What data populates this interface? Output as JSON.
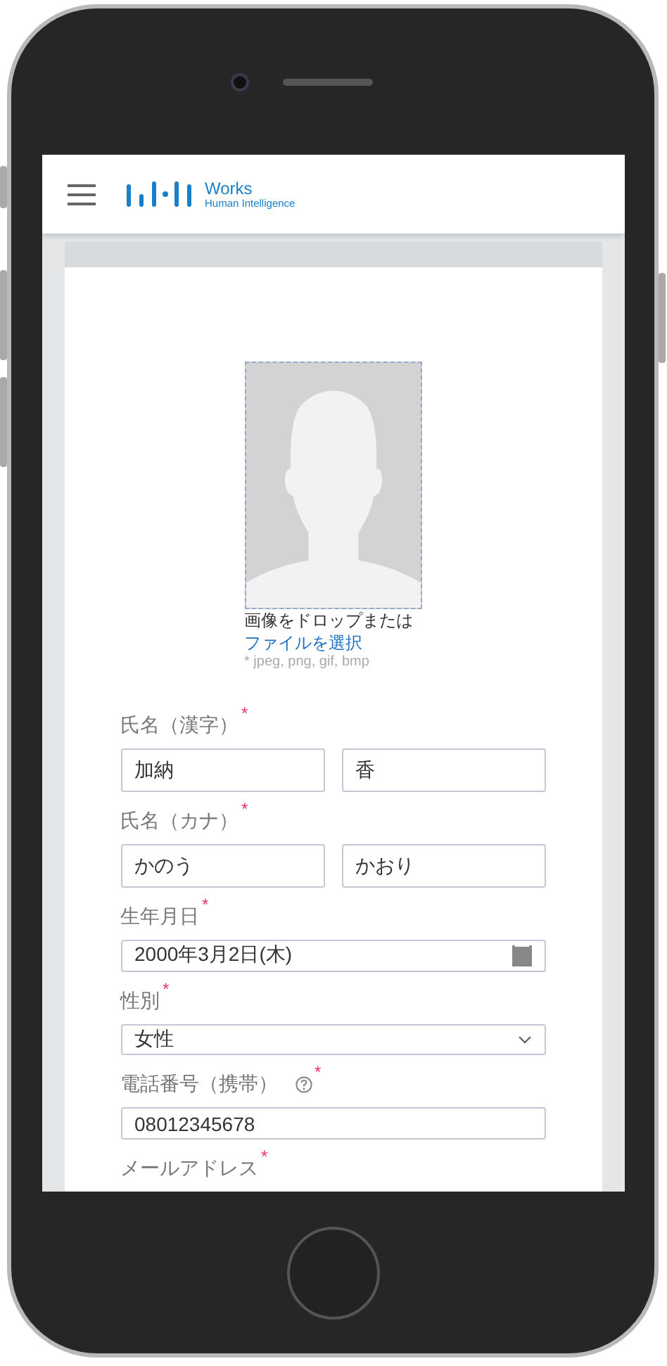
{
  "header": {
    "logo": {
      "title": "Works",
      "subtitle": "Human Intelligence"
    }
  },
  "upload": {
    "instruction": "画像をドロップまたは",
    "link": "ファイルを選択",
    "hint": "* jpeg, png, gif, bmp"
  },
  "fields": [
    {
      "kind": "pair",
      "label": "氏名（漢字）",
      "required_mark": "*",
      "help": false,
      "values": [
        "加納",
        "香"
      ]
    },
    {
      "kind": "pair",
      "label": "氏名（カナ）",
      "required_mark": "*",
      "help": false,
      "values": [
        "かのう",
        "かおり"
      ]
    },
    {
      "kind": "date",
      "label": "生年月日",
      "required_mark": "*",
      "help": false,
      "values": [
        "2000年3月2日(木)"
      ]
    },
    {
      "kind": "select",
      "label": "性別",
      "required_mark": "*",
      "help": false,
      "values": [
        "女性"
      ]
    },
    {
      "kind": "text",
      "label": "電話番号（携帯）",
      "required_mark": "*",
      "help": true,
      "values": [
        "08012345678"
      ]
    },
    {
      "kind": "label_only",
      "label": "メールアドレス",
      "required_mark": "*",
      "help": false
    }
  ]
}
